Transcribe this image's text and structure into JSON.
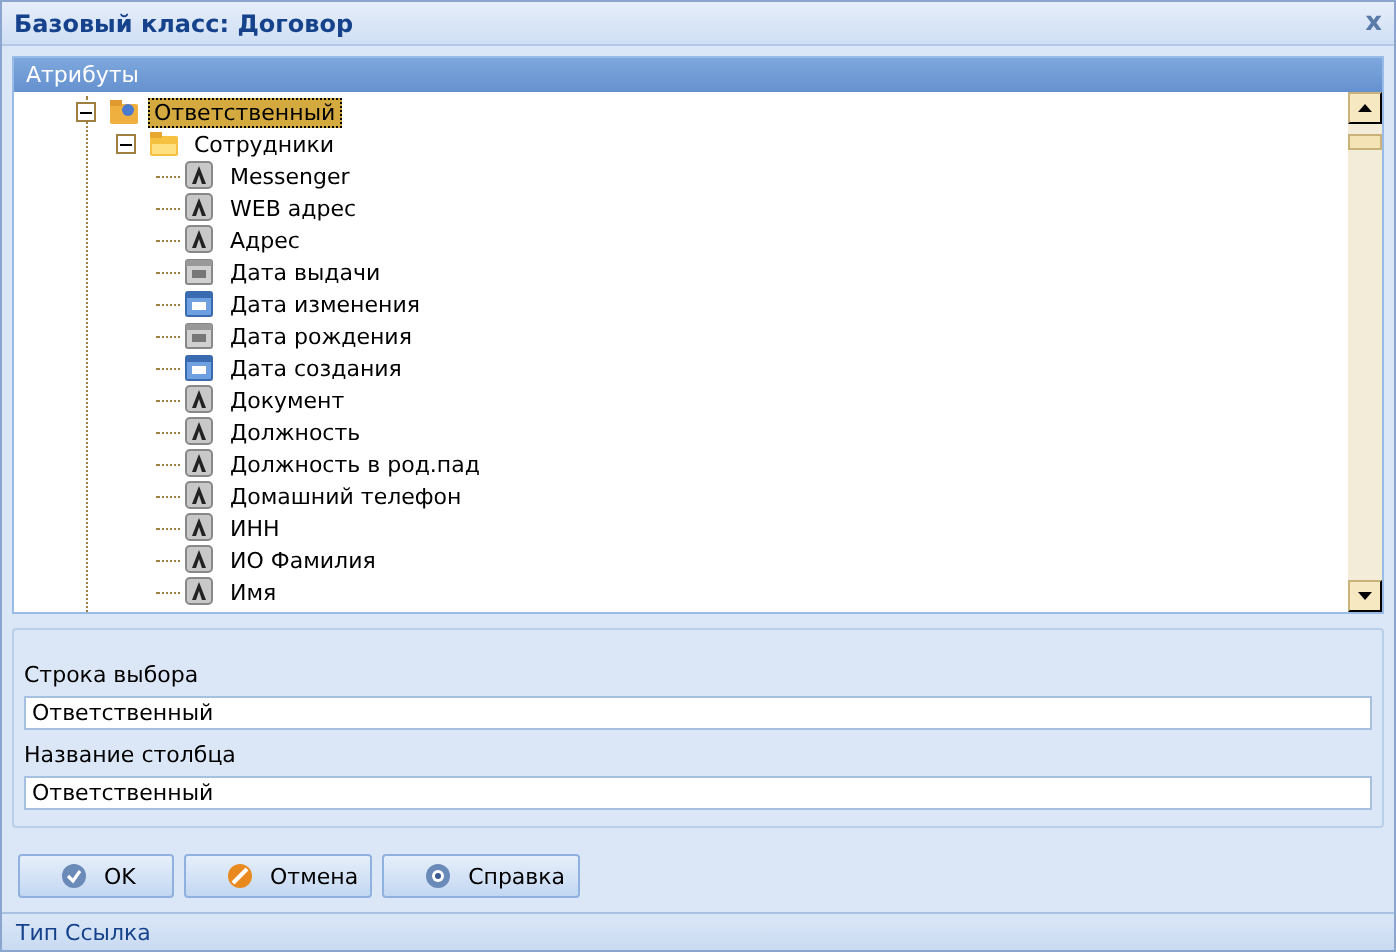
{
  "window": {
    "title": "Базовый класс: Договор",
    "close": "x"
  },
  "attributes_panel": {
    "title": "Атрибуты",
    "tree": [
      {
        "label": "Ответственный",
        "kind": "link",
        "expanded": true,
        "selected": true,
        "children": [
          {
            "label": "Сотрудники",
            "kind": "folder",
            "expanded": true,
            "selected": false,
            "children": [
              {
                "label": "Messenger",
                "kind": "text",
                "selected": false
              },
              {
                "label": "WEB адрес",
                "kind": "text",
                "selected": false
              },
              {
                "label": "Адрес",
                "kind": "text",
                "selected": false
              },
              {
                "label": "Дата выдачи",
                "kind": "date",
                "selected": false
              },
              {
                "label": "Дата изменения",
                "kind": "datetime",
                "selected": false
              },
              {
                "label": "Дата рождения",
                "kind": "date",
                "selected": false
              },
              {
                "label": "Дата создания",
                "kind": "datetime",
                "selected": false
              },
              {
                "label": "Документ",
                "kind": "text",
                "selected": false
              },
              {
                "label": "Должность",
                "kind": "text",
                "selected": false
              },
              {
                "label": "Должность в род.пад",
                "kind": "text",
                "selected": false
              },
              {
                "label": "Домашний телефон",
                "kind": "text",
                "selected": false
              },
              {
                "label": "ИНН",
                "kind": "text",
                "selected": false
              },
              {
                "label": "ИО Фамилия",
                "kind": "text",
                "selected": false
              },
              {
                "label": "Имя",
                "kind": "text",
                "selected": false
              }
            ]
          }
        ]
      }
    ]
  },
  "fields": [
    {
      "label": "Строка выбора",
      "value": "Ответственный"
    },
    {
      "label": "Название столбца",
      "value": "Ответственный"
    }
  ],
  "buttons": [
    {
      "label": "OK",
      "kind": "ok"
    },
    {
      "label": "Отмена",
      "kind": "cancel"
    },
    {
      "label": "Справка",
      "kind": "help"
    }
  ],
  "status_bar": "Тип Ссылка"
}
